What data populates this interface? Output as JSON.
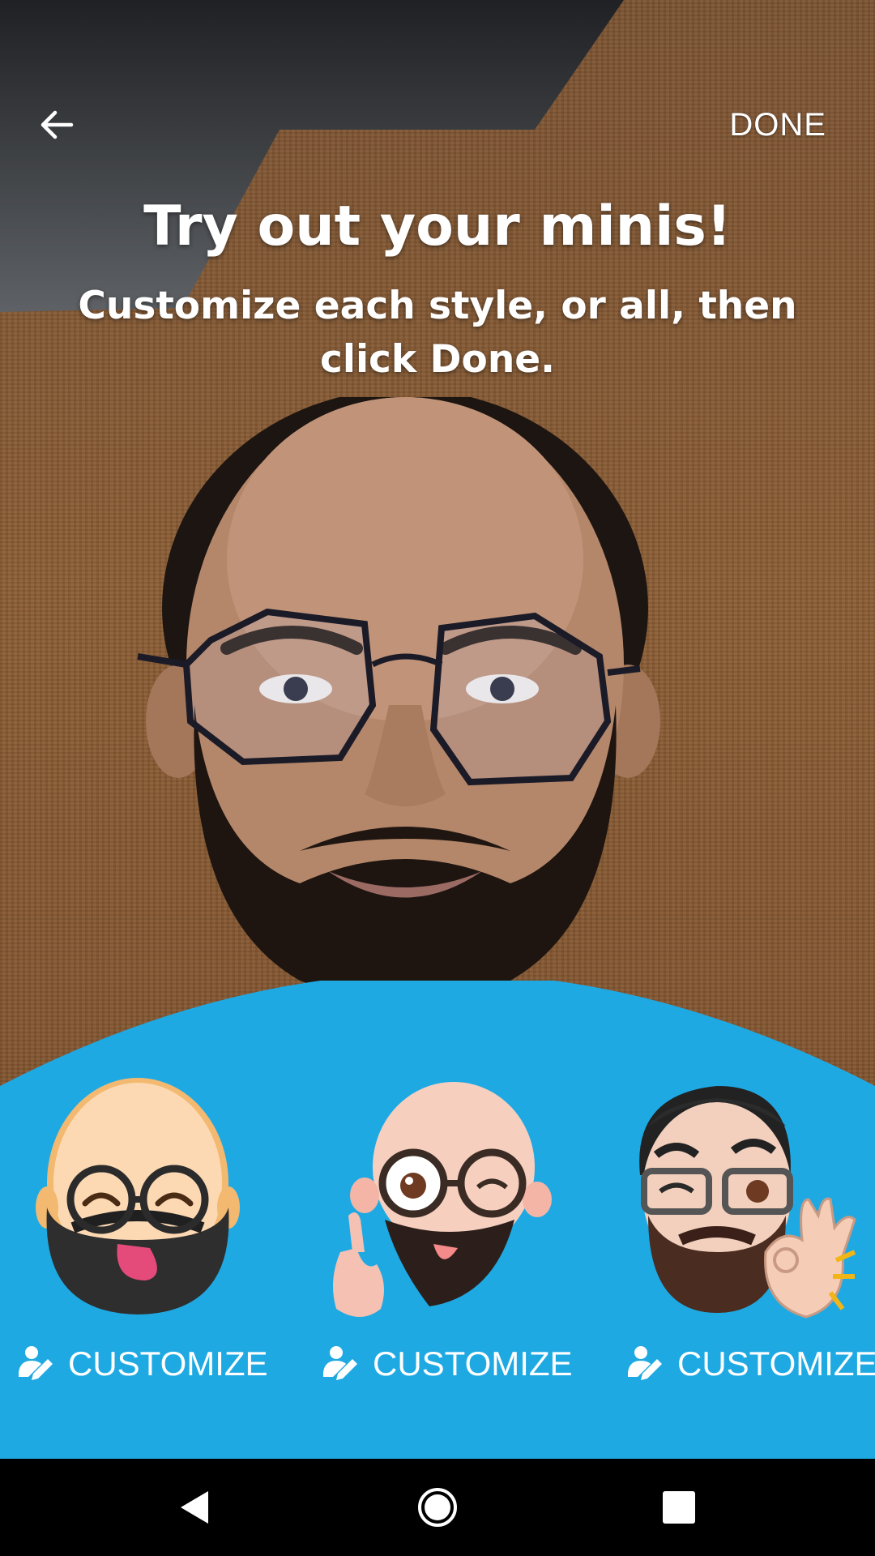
{
  "header": {
    "back_icon": "arrow-left-icon",
    "done_label": "DONE"
  },
  "title": "Try out your minis!",
  "subtitle": "Customize each style, or all, then click Done.",
  "colors": {
    "sheet_blue": "#1FA9E3",
    "text": "#FFFFFF",
    "nav_bar": "#000000"
  },
  "minis": [
    {
      "name": "mini-style-1",
      "customize_label": "CUSTOMIZE",
      "icon": "person-edit-icon"
    },
    {
      "name": "mini-style-2",
      "customize_label": "CUSTOMIZE",
      "icon": "person-edit-icon"
    },
    {
      "name": "mini-style-3",
      "customize_label": "CUSTOMIZE",
      "icon": "person-edit-icon"
    }
  ],
  "nav": {
    "back_icon": "nav-back-icon",
    "home_icon": "nav-home-icon",
    "recents_icon": "nav-recents-icon"
  }
}
